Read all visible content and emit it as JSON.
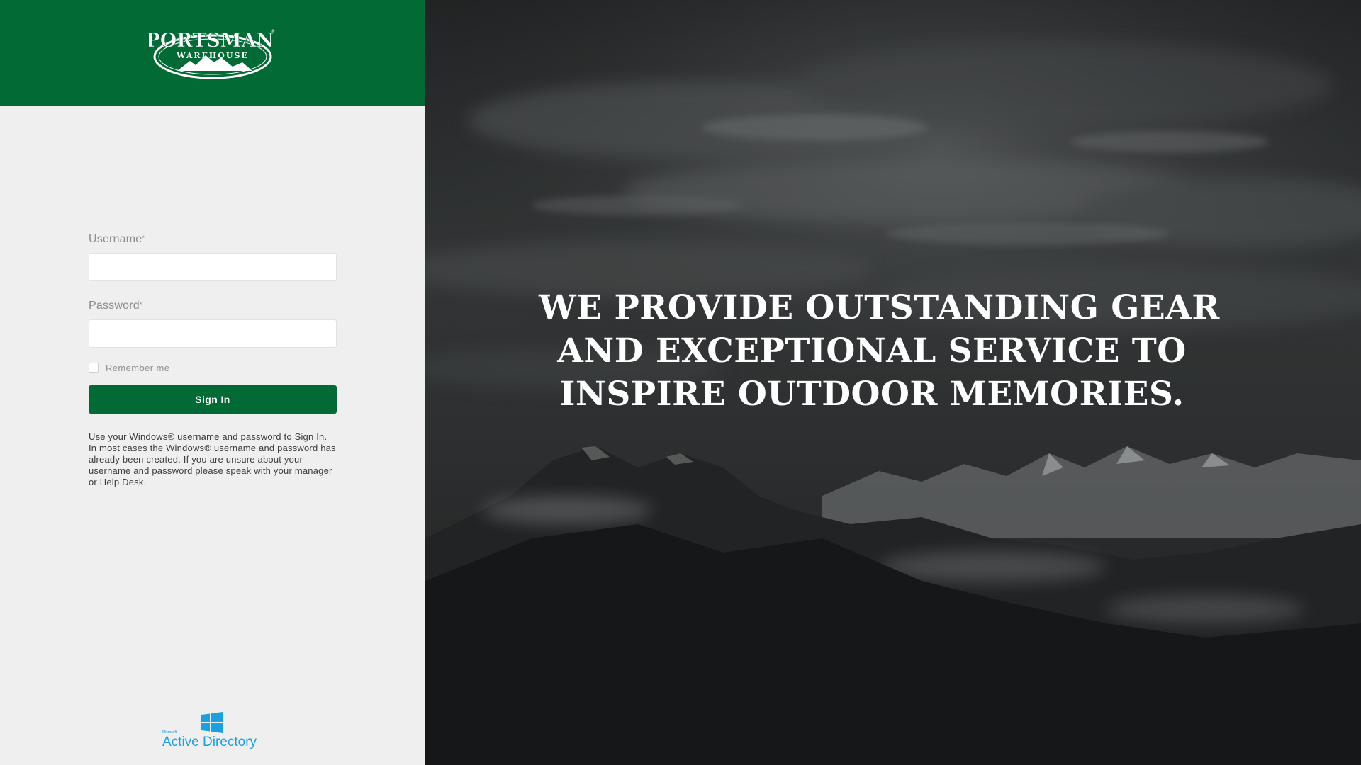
{
  "brand": {
    "logo_main": "SPORTSMAN'S",
    "logo_sub": "WAREHOUSE",
    "header_color": "#016a35"
  },
  "login": {
    "username_label": "Username",
    "username_required": "*",
    "username_value": "",
    "password_label": "Password",
    "password_required": "*",
    "password_value": "",
    "remember_label": "Remember me",
    "remember_checked": false,
    "signin_label": "Sign In",
    "help_text": "Use your Windows® username and password to Sign In. In most cases the Windows® username and password has already been created. If you are unsure about your username and password please speak with your manager or Help Desk."
  },
  "footer": {
    "ad_small": "Microsoft",
    "ad_label": "Active Directory",
    "ad_color": "#1ba1e2"
  },
  "hero": {
    "tagline_lines": [
      "WE PROVIDE OUTSTANDING GEAR",
      "AND EXCEPTIONAL SERVICE TO",
      "INSPIRE OUTDOOR MEMORIES."
    ]
  }
}
